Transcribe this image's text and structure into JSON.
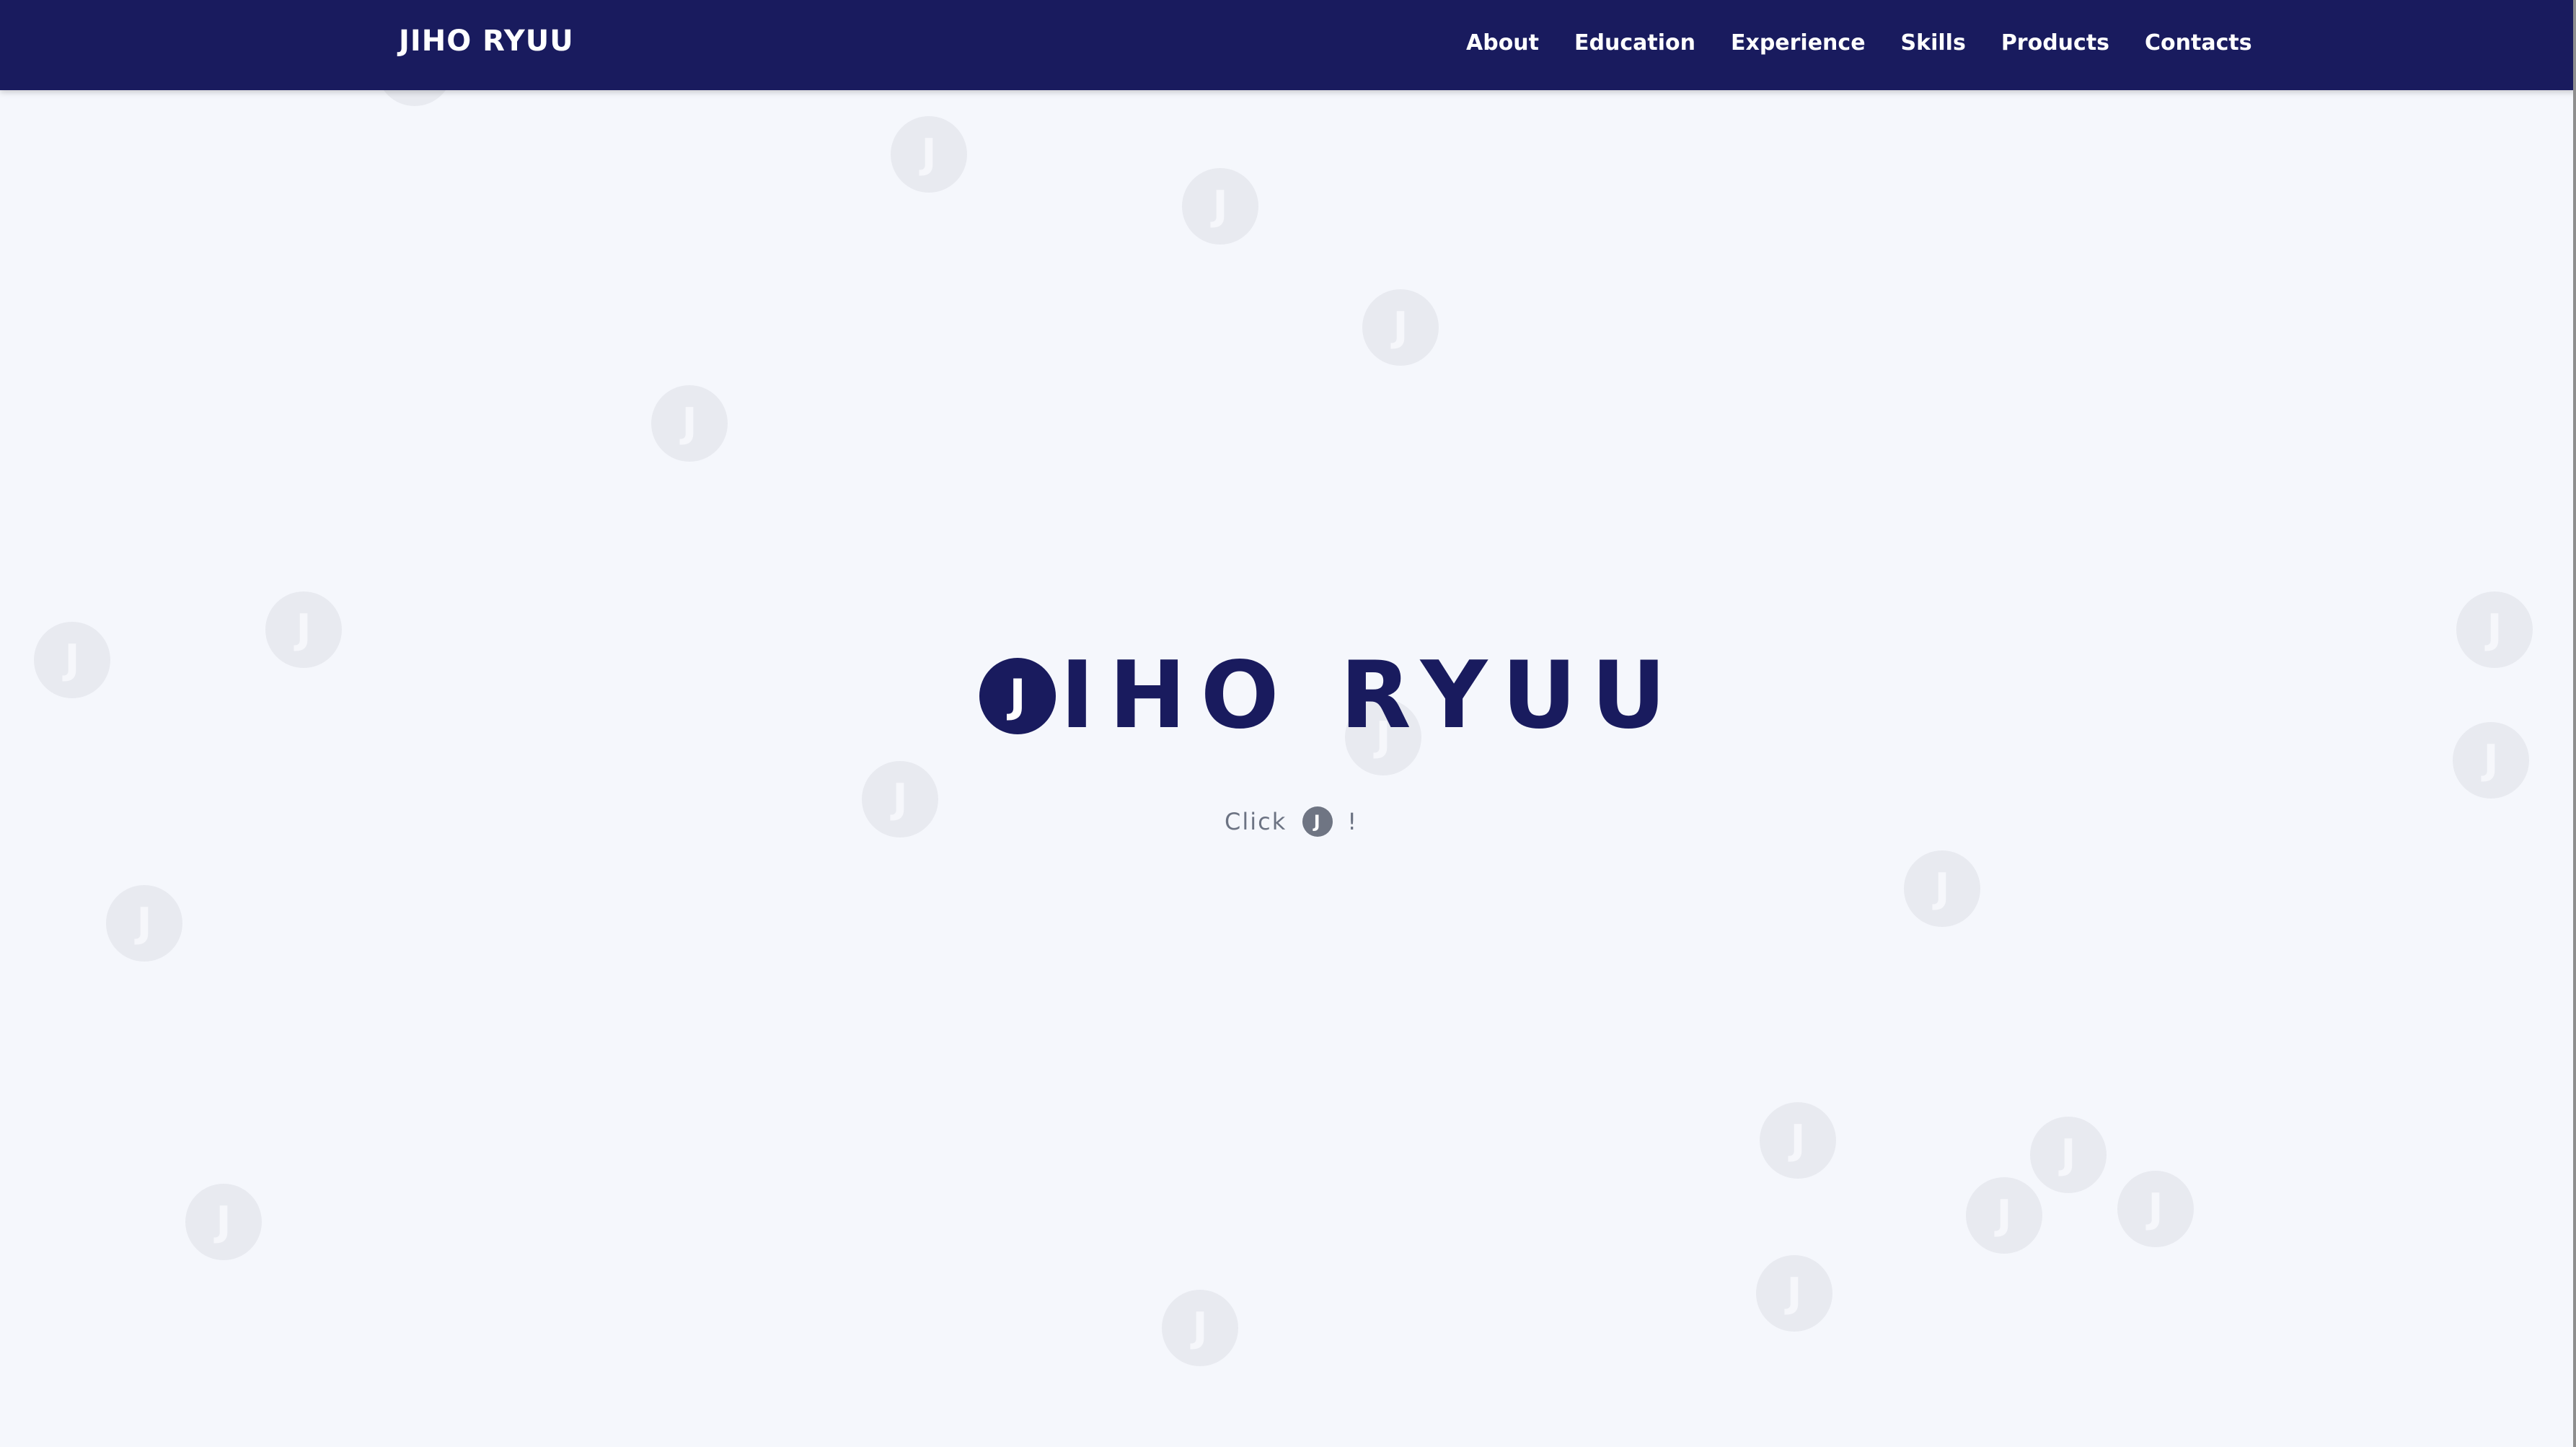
{
  "navbar": {
    "brand": "JIHO RYUU",
    "links": [
      "About",
      "Education",
      "Experience",
      "Skills",
      "Products",
      "Contacts"
    ]
  },
  "hero": {
    "j_glyph": "J",
    "name": "IHO RYUU",
    "hint_before": "Click",
    "hint_j": "J",
    "hint_after": "!"
  },
  "bubbles": {
    "glyph": "J"
  },
  "colors": {
    "navbar": "#191b5e",
    "accent": "#191b5e",
    "background": "#f5f7fc",
    "bubble": "#e8eaf0",
    "hint_text": "#6c7383"
  }
}
